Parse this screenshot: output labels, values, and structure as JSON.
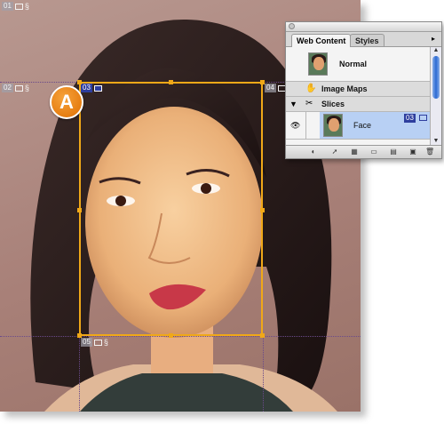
{
  "canvas": {
    "slices": [
      {
        "number": "01",
        "kind": "auto"
      },
      {
        "number": "02",
        "kind": "auto"
      },
      {
        "number": "03",
        "kind": "user"
      },
      {
        "number": "04",
        "kind": "auto"
      },
      {
        "number": "05",
        "kind": "auto"
      }
    ],
    "callout_label": "A"
  },
  "palette": {
    "tabs": [
      {
        "label": "Web Content",
        "active": true
      },
      {
        "label": "Styles",
        "active": false
      }
    ],
    "normal_row": {
      "label": "Normal"
    },
    "image_maps_row": {
      "label": "Image Maps"
    },
    "slices_row": {
      "label": "Slices"
    },
    "face_row": {
      "label": "Face",
      "slice_number": "03"
    }
  },
  "colors": {
    "slice_selection": "#f0a818",
    "user_slice_badge": "#2e3e9e",
    "selected_row": "#b8d0f4",
    "callout": "#e67e12"
  }
}
